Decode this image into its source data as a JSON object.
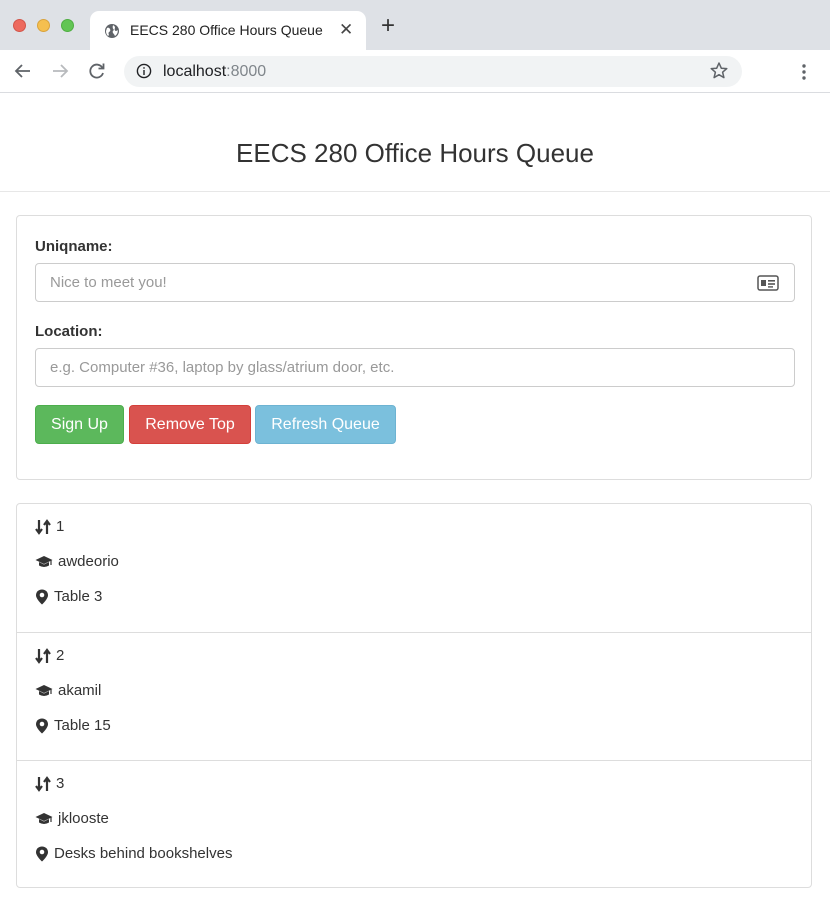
{
  "browser": {
    "tab_title": "EECS 280 Office Hours Queue",
    "new_tab_label": "+",
    "url_host": "localhost",
    "url_port": ":8000",
    "icons": [
      "globe-icon",
      "close-icon",
      "back-arrow-icon",
      "forward-arrow-icon",
      "reload-icon",
      "info-icon",
      "star-icon",
      "kebab-menu-icon"
    ]
  },
  "page": {
    "title": "EECS 280 Office Hours Queue"
  },
  "form": {
    "uniqname_label": "Uniqname:",
    "uniqname_placeholder": "Nice to meet you!",
    "uniqname_value": "",
    "location_label": "Location:",
    "location_placeholder": "e.g. Computer #36, laptop by glass/atrium door, etc.",
    "location_value": "",
    "buttons": {
      "signup": "Sign Up",
      "remove_top": "Remove Top",
      "refresh": "Refresh Queue"
    },
    "colors": {
      "signup": "#5cb85c",
      "remove_top": "#d9534f",
      "refresh": "#7bc0dd"
    }
  },
  "queue": [
    {
      "position": "1",
      "uniqname": "awdeorio",
      "location": "Table 3"
    },
    {
      "position": "2",
      "uniqname": "akamil",
      "location": "Table 15"
    },
    {
      "position": "3",
      "uniqname": "jklooste",
      "location": "Desks behind bookshelves"
    }
  ]
}
